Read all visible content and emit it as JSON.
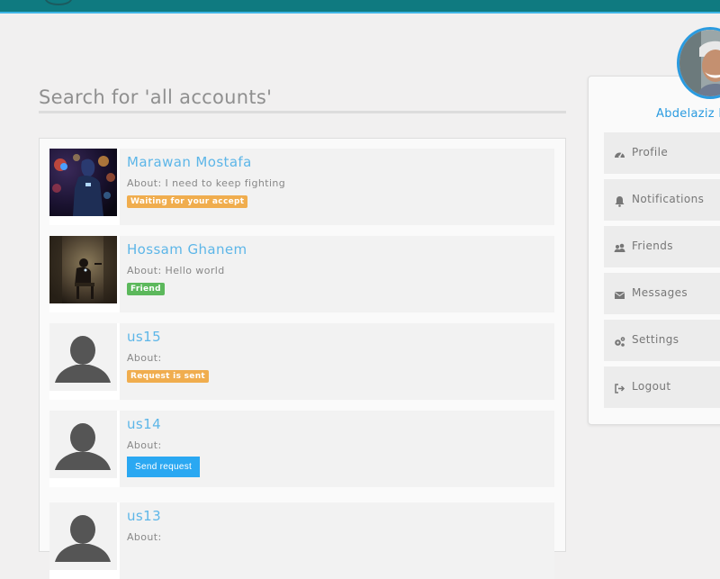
{
  "search": {
    "title": "Search for 'all accounts'"
  },
  "results": [
    {
      "name": "Marawan Mostafa",
      "about": "About: I need to keep fighting",
      "status": "Waiting for your accept",
      "status_kind": "badge-waiting"
    },
    {
      "name": "Hossam Ghanem",
      "about": "About: Hello world",
      "status": "Friend",
      "status_kind": "badge-friend"
    },
    {
      "name": "us15",
      "about": "About:",
      "status": "Request is sent",
      "status_kind": "badge-sent"
    },
    {
      "name": "us14",
      "about": "About:",
      "action": "Send request"
    },
    {
      "name": "us13",
      "about": "About:"
    }
  ],
  "sidebar": {
    "username": "Abdelaziz M",
    "items": [
      {
        "label": "Profile",
        "icon": "dashboard-icon"
      },
      {
        "label": "Notifications",
        "icon": "bell-icon"
      },
      {
        "label": "Friends",
        "icon": "users-icon"
      },
      {
        "label": "Messages",
        "icon": "envelope-icon"
      },
      {
        "label": "Settings",
        "icon": "gears-icon"
      },
      {
        "label": "Logout",
        "icon": "sign-out-icon"
      }
    ]
  },
  "colors": {
    "topbar": "#0f7a80",
    "topbar_accent": "#3fb6e6",
    "link_blue": "#5db6e8",
    "badge_orange": "#f0ad4e",
    "badge_green": "#5cb85c",
    "button_blue": "#2aa8f2"
  }
}
